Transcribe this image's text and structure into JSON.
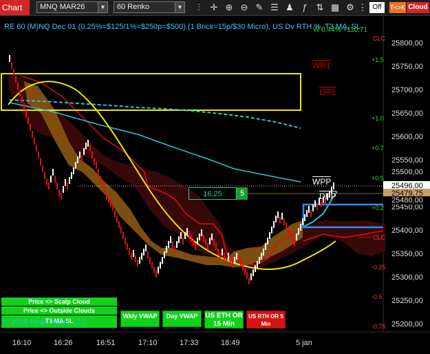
{
  "toolbar": {
    "tab_label": "Chart",
    "instrument": "MNQ MAR26",
    "period": "60 Renko",
    "icons": [
      "bar-type-icon",
      "crosshair-icon",
      "zoom-in-icon",
      "zoom-out-icon",
      "draw-pencil-icon",
      "properties-icon",
      "strategies-icon",
      "indicators-icon",
      "trade-icon",
      "data-box-icon"
    ],
    "off_label": "Off",
    "toggle_label": "T<>K",
    "cloud_label": "Cloud"
  },
  "chart": {
    "title_text": "RE 60 (M)NQ Dec 01 (0.25%=$125/1%=$250p=$500) (1 Brick=15p/$30 Micro), US Dv RTH %, T3 MA, SL",
    "watermark": "© 2026 NinjaTrader, LLC",
    "y_labels": [
      "25800,00",
      "25750,00",
      "25700,00",
      "25650,00",
      "25600,00",
      "25550,00",
      "25500,00",
      "25450,00",
      "25400,00",
      "25350,00",
      "25300,00",
      "25250,00",
      "25200,00"
    ],
    "x_labels": [
      "16:10",
      "16:26",
      "16:51",
      "17:10",
      "17:33",
      "18:49",
      "5 jan"
    ],
    "green_annotations": [
      "W 0,44% +110,71",
      "+1.5",
      "+1.0",
      "+0.7",
      "+0.5",
      "+0.2"
    ],
    "red_annotations": [
      "CLC",
      "CLC",
      "-0.25",
      "-0.5",
      "-0.75"
    ],
    "levels": {
      "wr1": "WR1",
      "dr1": "DR1",
      "wpp": "WPP",
      "dpp": "DPP"
    },
    "price_tags": {
      "last": "25496,00",
      "ask": "25479,75",
      "bid": "25480,00"
    },
    "risk_reward_value": "16,25",
    "risk_reward_qty": "5",
    "colors": {
      "up_brick": "#ffffff",
      "down_brick": "#e01010",
      "cloud_red": "#3a0a0a",
      "cloud_gold": "#8a5a10",
      "t3_ma": "#f2e600",
      "cyan_ma": "#29c6d8",
      "zone": "#f2e600",
      "pivot_box": "#2f8ff0"
    }
  },
  "buttons": {
    "scalp_cloud": "Price <> Scalp Cloud",
    "outside_clouds": "Price <> Outside Clouds",
    "t3_sl": "T3 MA SL",
    "wkly_vwap": "Wkly VWAP",
    "day_vwap": "Day VWAP",
    "us_eth": "US ETH OR 15 Min",
    "us_rth": "US RTH OR 5 Min"
  }
}
